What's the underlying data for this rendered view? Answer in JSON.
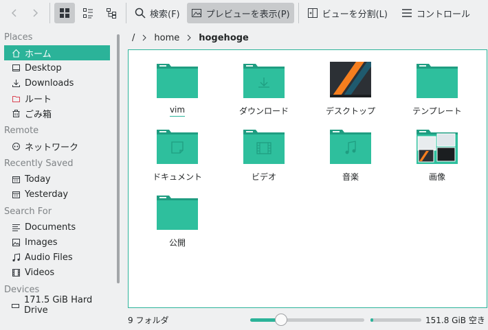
{
  "toolbar": {
    "back_icon": "chevron-left-icon",
    "forward_icon": "chevron-right-icon",
    "view_icons": "icons-view-icon",
    "view_compact": "compact-view-icon",
    "view_tree": "tree-view-icon",
    "search_label": "検索(F)",
    "preview_label": "プレビューを表示(P)",
    "split_label": "ビューを分割(L)",
    "control_label": "コントロール"
  },
  "sidebar": {
    "sections": [
      {
        "title": "Places",
        "items": [
          {
            "label": "ホーム",
            "icon": "home-icon",
            "selected": true
          },
          {
            "label": "Desktop",
            "icon": "desktop-icon"
          },
          {
            "label": "Downloads",
            "icon": "download-icon"
          },
          {
            "label": "ルート",
            "icon": "folder-red-icon"
          },
          {
            "label": "ごみ箱",
            "icon": "trash-icon"
          }
        ]
      },
      {
        "title": "Remote",
        "items": [
          {
            "label": "ネットワーク",
            "icon": "network-icon"
          }
        ]
      },
      {
        "title": "Recently Saved",
        "items": [
          {
            "label": "Today",
            "icon": "calendar-icon"
          },
          {
            "label": "Yesterday",
            "icon": "calendar-icon"
          }
        ]
      },
      {
        "title": "Search For",
        "items": [
          {
            "label": "Documents",
            "icon": "document-icon"
          },
          {
            "label": "Images",
            "icon": "image-icon"
          },
          {
            "label": "Audio Files",
            "icon": "music-icon"
          },
          {
            "label": "Videos",
            "icon": "video-icon"
          }
        ]
      },
      {
        "title": "Devices",
        "items": [
          {
            "label": "171.5 GiB Hard Drive",
            "icon": "drive-icon"
          }
        ]
      }
    ]
  },
  "breadcrumb": {
    "root": "/",
    "home": "home",
    "current": "hogehoge"
  },
  "files": [
    {
      "label": "vim",
      "type": "folder"
    },
    {
      "label": "ダウンロード",
      "type": "folder-download"
    },
    {
      "label": "デスクトップ",
      "type": "desktop"
    },
    {
      "label": "テンプレート",
      "type": "folder"
    },
    {
      "label": "ドキュメント",
      "type": "folder-document"
    },
    {
      "label": "ビデオ",
      "type": "folder-video"
    },
    {
      "label": "音楽",
      "type": "folder-music"
    },
    {
      "label": "画像",
      "type": "folder-pictures"
    },
    {
      "label": "公開",
      "type": "folder"
    }
  ],
  "status": {
    "folder_count": "9 フォルダ",
    "zoom_level": 0.27,
    "space_used_fraction": 0.06,
    "free_space": "151.8 GiB 空き"
  },
  "colors": {
    "accent": "#2bb399",
    "folder_body": "#2ebf9d",
    "folder_tab": "#1f9d81"
  }
}
